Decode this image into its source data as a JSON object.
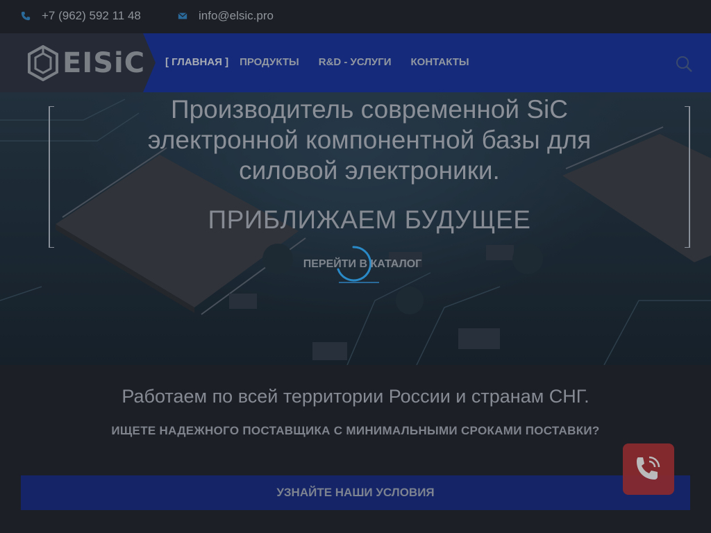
{
  "topbar": {
    "phone": "+7 (962) 592 11 48",
    "email": "info@elsic.pro"
  },
  "logo": {
    "text": "EISiC"
  },
  "nav": {
    "items": [
      {
        "label": "[ ГЛАВНАЯ ]"
      },
      {
        "label": "ПРОДУКТЫ"
      },
      {
        "label": "R&D - УСЛУГИ"
      },
      {
        "label": "КОНТАКТЫ"
      }
    ]
  },
  "hero": {
    "title_lines": [
      "Производитель современной SiC",
      "электронной компонентной базы для",
      "силовой электроники."
    ],
    "subtitle": "ПРИБЛИЖАЕМ БУДУЩЕЕ",
    "cta": "ПЕРЕЙТИ В КАТАЛОГ"
  },
  "info": {
    "headline": "Работаем по всей территории России и странам СНГ.",
    "question": "ИЩЕТЕ НАДЕЖНОГО ПОСТАВЩИКА С МИНИМАЛЬНЫМИ СРОКАМИ ПОСТАВКИ?",
    "button": "УЗНАЙТЕ НАШИ УСЛОВИЯ"
  },
  "colors": {
    "background": "#1d1f27",
    "nav_band": "#152a7a",
    "terms_button": "#142466",
    "call_button": "#8a2a2e",
    "accent_blue": "#2a6a9a"
  },
  "icons": {
    "phone": "phone-icon",
    "email": "envelope-icon",
    "search": "search-icon",
    "call": "phone-call-icon",
    "loader": "loading-spinner-icon"
  }
}
